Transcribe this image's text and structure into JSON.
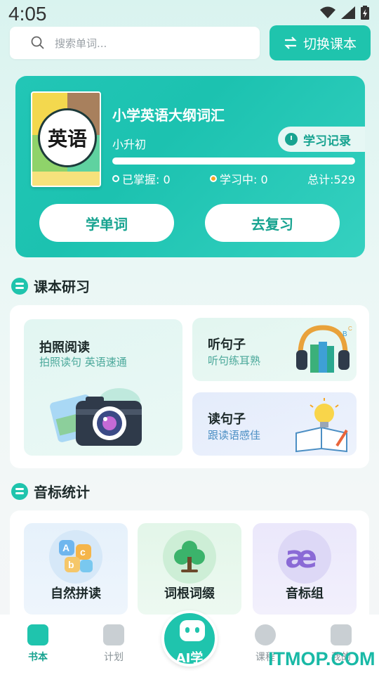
{
  "status": {
    "time": "4:05"
  },
  "search": {
    "placeholder": "搜索单词..."
  },
  "switch_button": {
    "label": "切换课本"
  },
  "book": {
    "cover_text": "英语",
    "title": "小学英语大纲词汇",
    "subtitle": "小升初",
    "record_label": "学习记录",
    "progress": 0,
    "mastered_label": "已掌握: 0",
    "learning_label": "学习中: 0",
    "total_label": "总计:529",
    "learn_button": "学单词",
    "review_button": "去复习"
  },
  "section1": {
    "title": "课本研习",
    "photo": {
      "title": "拍照阅读",
      "subtitle": "拍照读句 英语速通"
    },
    "listen": {
      "title": "听句子",
      "subtitle": "听句练耳熟"
    },
    "read": {
      "title": "读句子",
      "subtitle": "跟读语感佳"
    }
  },
  "section2": {
    "title": "音标统计",
    "items": [
      {
        "label": "自然拼读",
        "icon": "abc-blocks-icon"
      },
      {
        "label": "词根词缀",
        "icon": "tree-icon"
      },
      {
        "label": "音标组",
        "icon": "ae-symbol-icon"
      }
    ]
  },
  "tabbar": {
    "tabs": [
      {
        "label": "书本"
      },
      {
        "label": "计划"
      },
      {
        "label": "AI学"
      },
      {
        "label": "课程"
      },
      {
        "label": "我的"
      }
    ]
  },
  "watermark": "ITMOP.COM",
  "colors": {
    "accent": "#1fc4ad",
    "accent_dark": "#17a390"
  }
}
